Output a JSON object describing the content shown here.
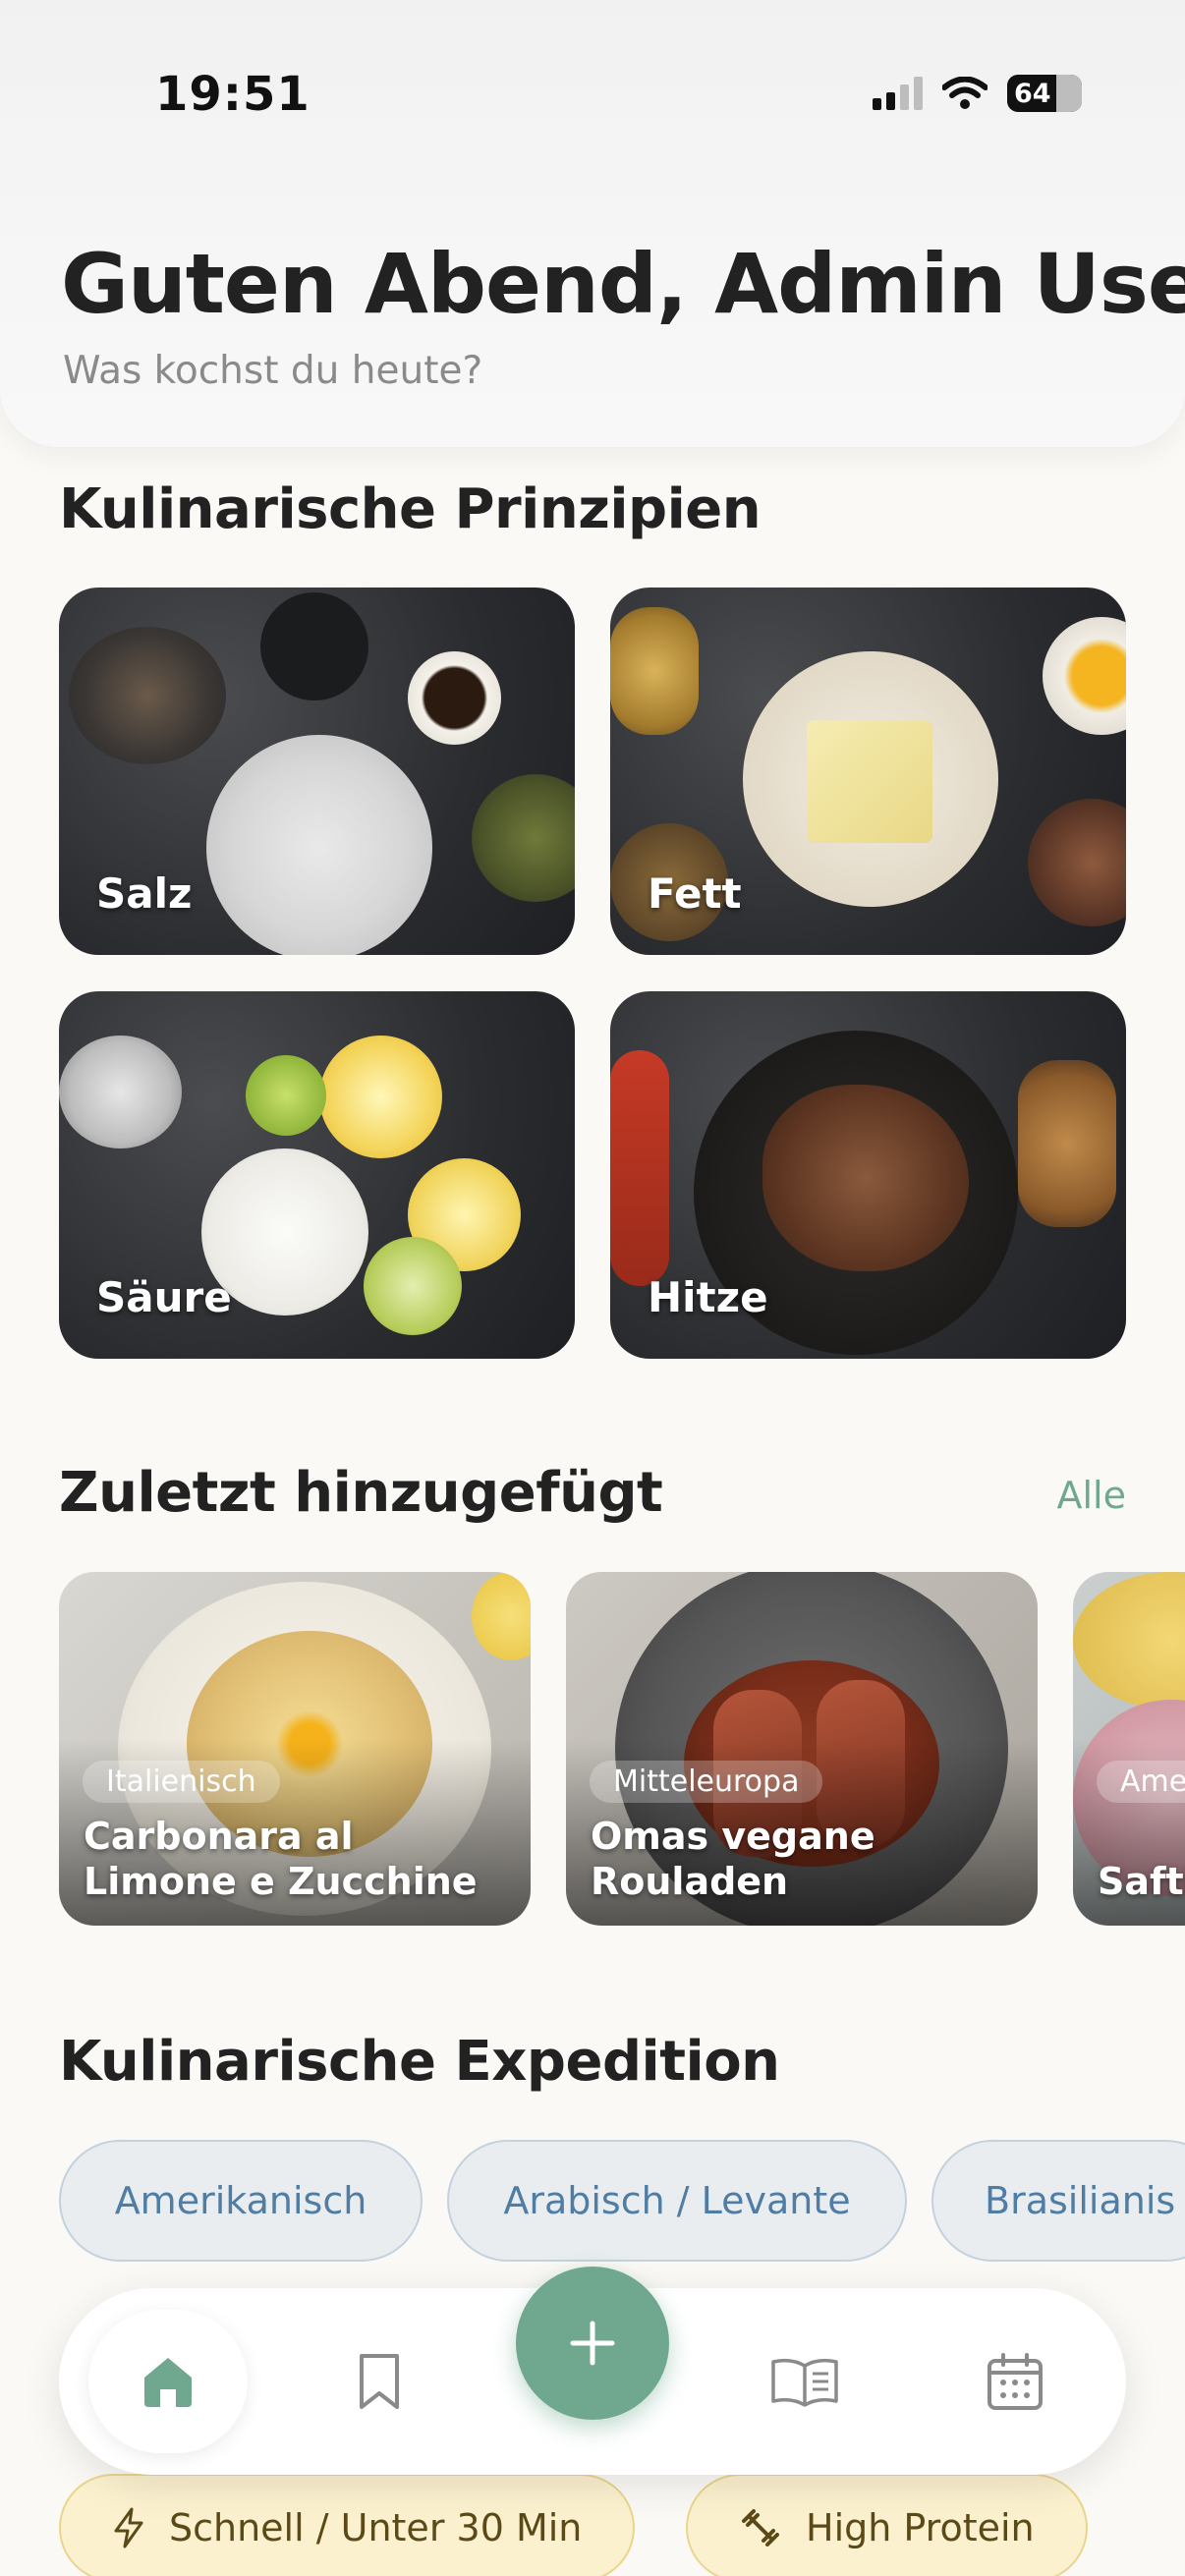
{
  "status_bar": {
    "time": "19:51",
    "battery": "64"
  },
  "header": {
    "greeting": "Guten Abend, Admin Use...",
    "subtitle": "Was kochst du heute?"
  },
  "principles": {
    "title": "Kulinarische Prinzipien",
    "cards": [
      {
        "label": "Salz"
      },
      {
        "label": "Fett"
      },
      {
        "label": "Säure"
      },
      {
        "label": "Hitze"
      }
    ]
  },
  "recent": {
    "title": "Zuletzt hinzugefügt",
    "see_all": "Alle",
    "cards": [
      {
        "cuisine": "Italienisch",
        "title": "Carbonara al Limone e Zucchine"
      },
      {
        "cuisine": "Mitteleuropa",
        "title": "Omas vegane Rouladen"
      },
      {
        "cuisine": "Ame",
        "title": "Safti Bana"
      }
    ]
  },
  "expedition": {
    "title": "Kulinarische Expedition",
    "chips": [
      "Amerikanisch",
      "Arabisch / Levante",
      "Brasilianis"
    ]
  },
  "quick_filters": [
    "Schnell / Unter 30 Min",
    "High Protein"
  ],
  "nav": {
    "items": [
      "home-icon",
      "bookmark-icon",
      "plus-icon",
      "book-icon",
      "calendar-icon"
    ],
    "accent": "#6fa88e"
  }
}
